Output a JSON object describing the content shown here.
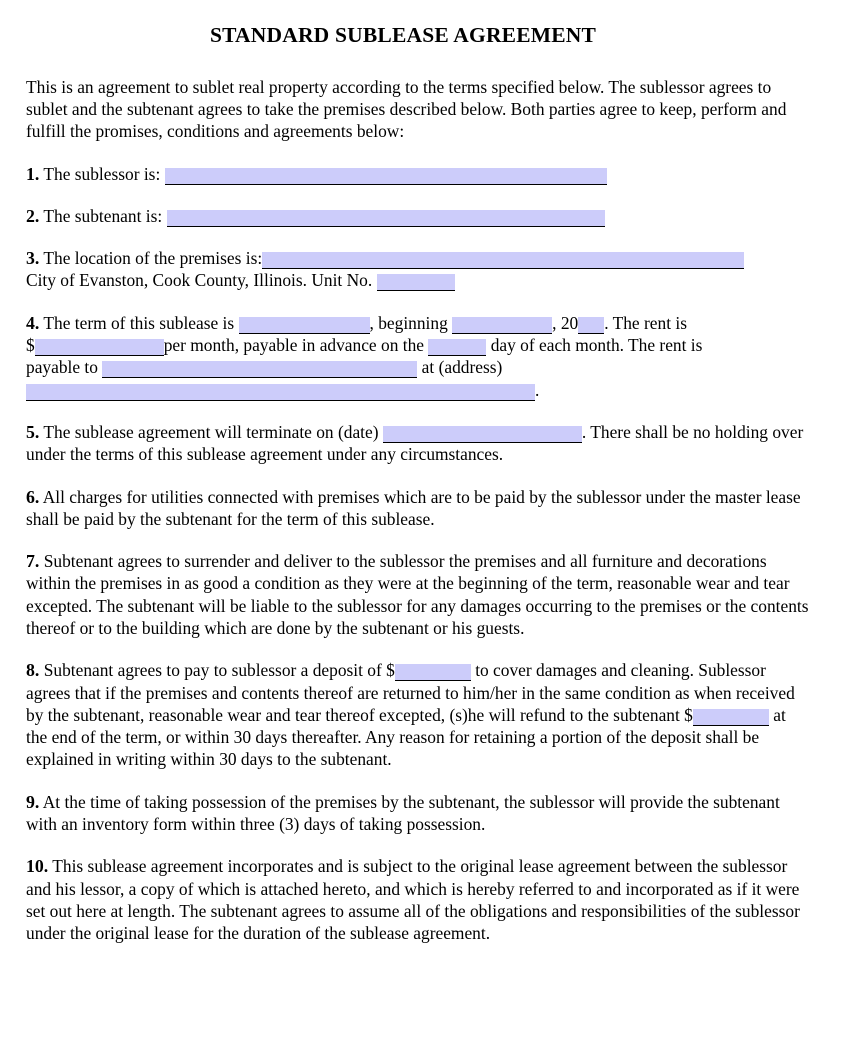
{
  "document": {
    "title": "STANDARD SUBLEASE AGREEMENT",
    "intro": "This is an agreement to sublet real property according to the terms specified below. The sublessor agrees to sublet and the subtenant agrees to take the premises described below. Both parties agree to keep, perform and fulfill the promises, conditions and agreements below:"
  },
  "clauses": {
    "c1": {
      "number": "1.",
      "text_before": "The sublessor is:",
      "field_value": ""
    },
    "c2": {
      "number": "2.",
      "text_before": "The subtenant is:",
      "field_value": ""
    },
    "c3": {
      "number": "3.",
      "text_before": "The location of the premises is:",
      "field_value": "",
      "line2_before": "City of Evanston, Cook County, Illinois. Unit No.",
      "unit_value": ""
    },
    "c4": {
      "number": "4.",
      "t1": "The term of this sublease is",
      "term_value": "",
      "t2": ", beginning",
      "beginning_value": "",
      "t3": ", 20",
      "year_value": "",
      "t4": ". The rent is",
      "t5": "$",
      "rent_value": "",
      "t6": "per month, payable in advance on the",
      "day_value": "",
      "t7": "day of each month. The rent is",
      "t8": "payable to",
      "payable_to_value": "",
      "t9": "at (address)",
      "address_value": "",
      "t10": "."
    },
    "c5": {
      "number": "5.",
      "t1": "The sublease agreement will terminate on (date)",
      "terminate_value": "",
      "t2": ". There shall be no holding over under the terms of this sublease agreement under any circumstances."
    },
    "c6": {
      "number": "6.",
      "text": "All charges for utilities connected with premises which are to be paid by the sublessor under the master lease shall be paid by the subtenant for the term of this sublease."
    },
    "c7": {
      "number": "7.",
      "text": "Subtenant agrees to surrender and deliver to the sublessor the premises and all furniture and decorations within the premises in as good a condition as they were at the beginning of the term, reasonable wear and tear excepted. The subtenant will be liable to the sublessor for any damages occurring to the premises or the contents thereof or to the building which are done by the subtenant or his guests."
    },
    "c8": {
      "number": "8.",
      "t1": "Subtenant agrees to pay to sublessor a deposit of $",
      "deposit_value": "",
      "t2": "to cover damages and cleaning. Sublessor agrees that if the premises and contents thereof are returned to him/her in the same condition as when received by the subtenant, reasonable wear and tear thereof excepted, (s)he will refund to the subtenant $",
      "refund_value": "",
      "t3": "at the end of the term, or within 30 days thereafter. Any reason for retaining a portion of the deposit shall be explained in writing within 30 days to the subtenant."
    },
    "c9": {
      "number": "9.",
      "text": "At the time of taking possession of the premises by the subtenant, the sublessor will provide the subtenant with an inventory form within three (3) days of taking possession."
    },
    "c10": {
      "number": "10.",
      "text": "This sublease agreement incorporates and is subject to the original lease agreement between the sublessor and his lessor, a copy of which is attached hereto, and which is hereby referred to and incorporated as if it were set out here at length. The subtenant agrees to assume all of the obligations and responsibilities of the sublessor under the original lease for the duration of the sublease agreement."
    }
  },
  "style": {
    "field_fill_color": "#ccccfa",
    "text_color": "#000000",
    "page_background": "#ffffff"
  }
}
